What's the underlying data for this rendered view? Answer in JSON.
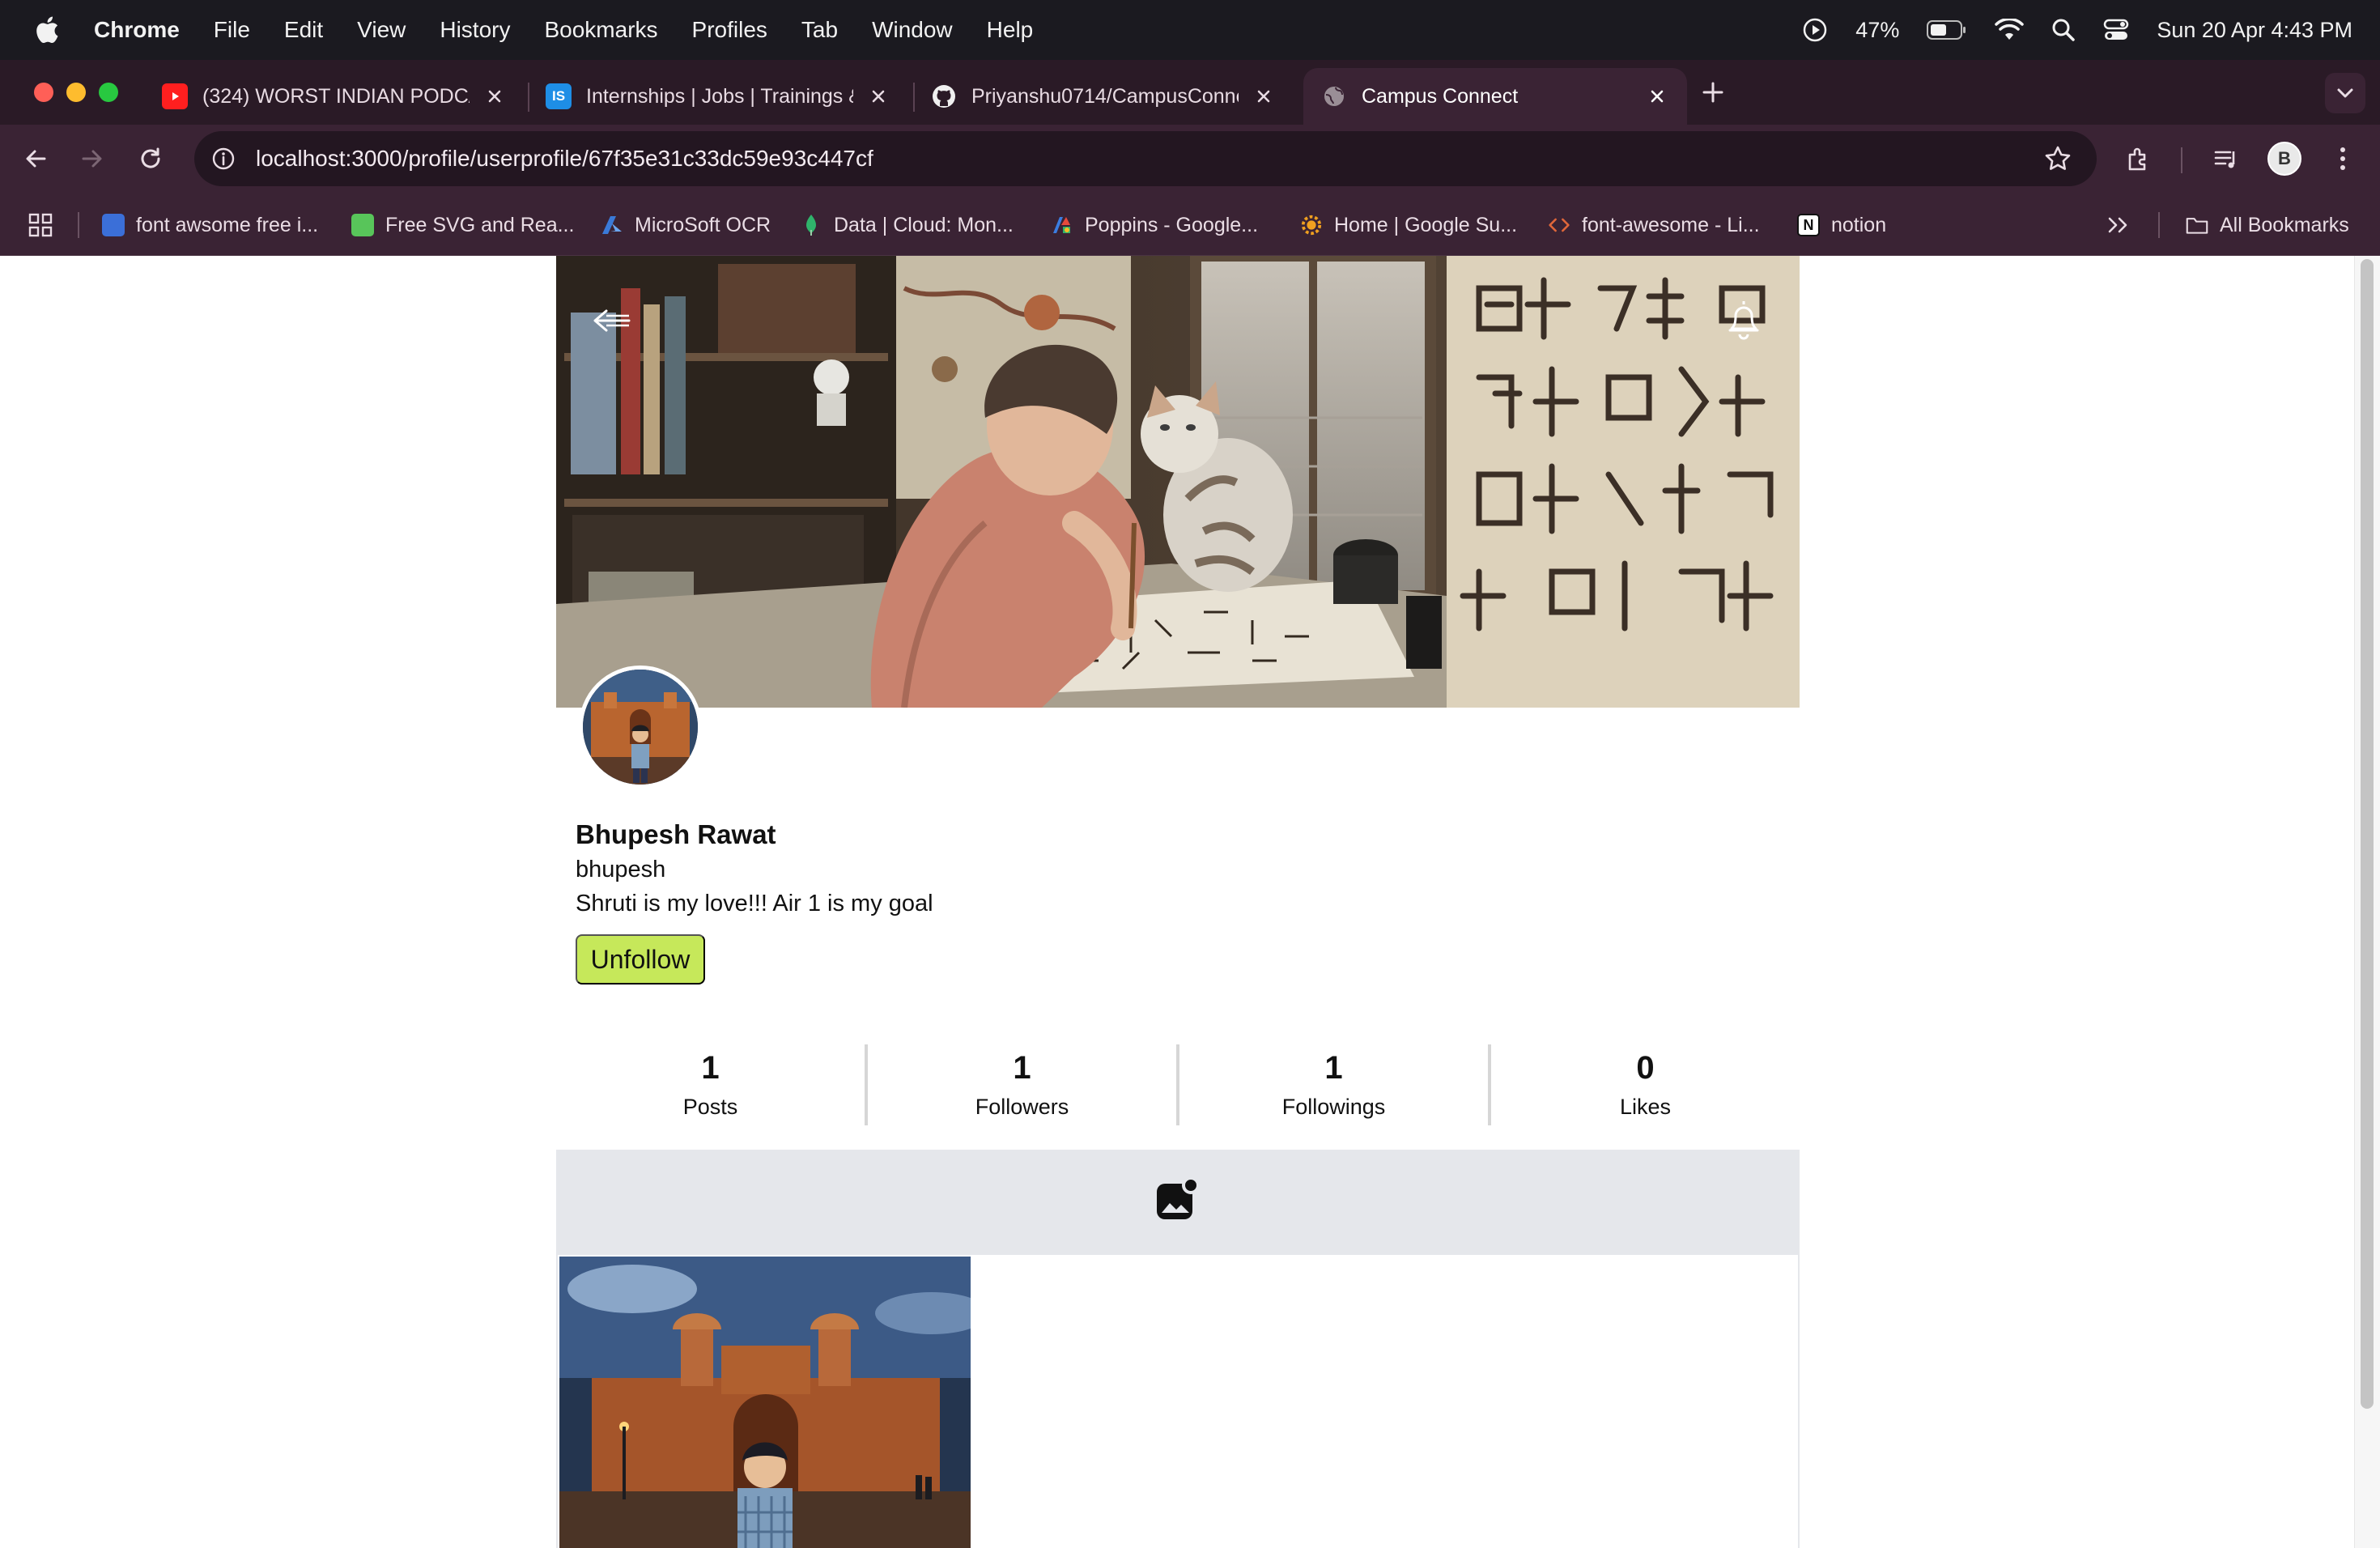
{
  "menubar": {
    "app": "Chrome",
    "items": [
      "File",
      "Edit",
      "View",
      "History",
      "Bookmarks",
      "Profiles",
      "Tab",
      "Window",
      "Help"
    ],
    "battery": "47%",
    "datetime": "Sun 20 Apr  4:43 PM"
  },
  "tabs": [
    {
      "title": "(324) WORST INDIAN PODCA",
      "icon": "youtube-icon"
    },
    {
      "title": "Internships | Jobs | Trainings &",
      "icon": "internshala-icon"
    },
    {
      "title": "Priyanshu0714/CampusConne",
      "icon": "github-icon"
    },
    {
      "title": "Campus Connect",
      "icon": "globe-icon"
    }
  ],
  "address": {
    "url": "localhost:3000/profile/userprofile/67f35e31c33dc59e93c447cf"
  },
  "bookmarks": {
    "items": [
      {
        "label": "font awsome free i...",
        "color": "#3b6fd8"
      },
      {
        "label": "Free SVG and Rea...",
        "color": "#58c55a"
      },
      {
        "label": "MicroSoft OCR",
        "color": "#3a7ad8"
      },
      {
        "label": "Data | Cloud: Mon...",
        "color": "#2fb36b"
      },
      {
        "label": "Poppins - Google...",
        "color": "#e0a030"
      },
      {
        "label": "Home | Google Su...",
        "color": "#f0a020"
      },
      {
        "label": "font-awesome - Li...",
        "color": "#e0673a"
      },
      {
        "label": "notion",
        "color": "#ffffff"
      }
    ],
    "all_label": "All Bookmarks"
  },
  "profile": {
    "name": "Bhupesh Rawat",
    "username": "bhupesh",
    "bio": "Shruti is my love!!! Air 1 is my goal",
    "action_label": "Unfollow",
    "accent": "#c6e85a"
  },
  "stats": [
    {
      "value": "1",
      "label": "Posts"
    },
    {
      "value": "1",
      "label": "Followers"
    },
    {
      "value": "1",
      "label": "Followings"
    },
    {
      "value": "0",
      "label": "Likes"
    }
  ]
}
